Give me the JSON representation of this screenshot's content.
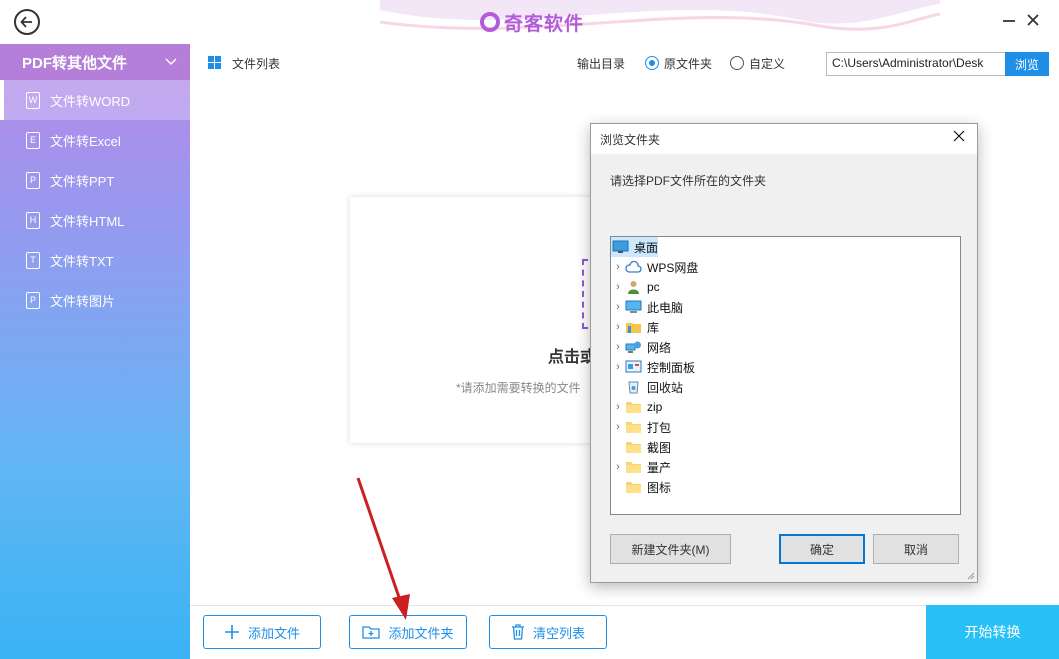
{
  "app": {
    "title": "奇客软件"
  },
  "sidebar": {
    "header": "PDF转其他文件",
    "items": [
      {
        "label": "文件转WORD",
        "letter": "W"
      },
      {
        "label": "文件转Excel",
        "letter": "E"
      },
      {
        "label": "文件转PPT",
        "letter": "P"
      },
      {
        "label": "文件转HTML",
        "letter": "H"
      },
      {
        "label": "文件转TXT",
        "letter": "T"
      },
      {
        "label": "文件转图片",
        "letter": "P"
      }
    ]
  },
  "toolbar": {
    "list_label": "文件列表",
    "output_label": "输出目录",
    "option_original": "原文件夹",
    "option_custom": "自定义",
    "path_value": "C:\\Users\\Administrator\\Desk",
    "browse_label": "浏览"
  },
  "drop": {
    "title": "点击或",
    "hint": "*请添加需要转换的文件"
  },
  "bottom": {
    "add_file": "添加文件",
    "add_folder": "添加文件夹",
    "clear_list": "清空列表",
    "start": "开始转换"
  },
  "dialog": {
    "title": "浏览文件夹",
    "prompt": "请选择PDF文件所在的文件夹",
    "tree": [
      {
        "label": "桌面",
        "icon": "desktop-icon",
        "expander": false,
        "level": 0,
        "selected": true
      },
      {
        "label": "WPS网盘",
        "icon": "cloud-icon",
        "expander": true,
        "level": 1
      },
      {
        "label": "pc",
        "icon": "user-icon",
        "expander": true,
        "level": 1
      },
      {
        "label": "此电脑",
        "icon": "computer-icon",
        "expander": true,
        "level": 1
      },
      {
        "label": "库",
        "icon": "library-icon",
        "expander": true,
        "level": 1
      },
      {
        "label": "网络",
        "icon": "network-icon",
        "expander": true,
        "level": 1
      },
      {
        "label": "控制面板",
        "icon": "control-panel-icon",
        "expander": true,
        "level": 1
      },
      {
        "label": "回收站",
        "icon": "recycle-bin-icon",
        "expander": false,
        "level": 1
      },
      {
        "label": "zip",
        "icon": "folder-icon",
        "expander": true,
        "level": 1
      },
      {
        "label": "打包",
        "icon": "folder-icon",
        "expander": true,
        "level": 1
      },
      {
        "label": "截图",
        "icon": "folder-icon",
        "expander": false,
        "level": 1
      },
      {
        "label": "量产",
        "icon": "folder-icon",
        "expander": true,
        "level": 1
      },
      {
        "label": "图标",
        "icon": "folder-icon",
        "expander": false,
        "level": 1
      }
    ],
    "new_folder": "新建文件夹(M)",
    "ok": "确定",
    "cancel": "取消"
  },
  "colors": {
    "accent": "#1e8fe8",
    "brand": "#b35cd9",
    "start_button": "#27c1f7",
    "arrow": "#cc1f1f"
  }
}
